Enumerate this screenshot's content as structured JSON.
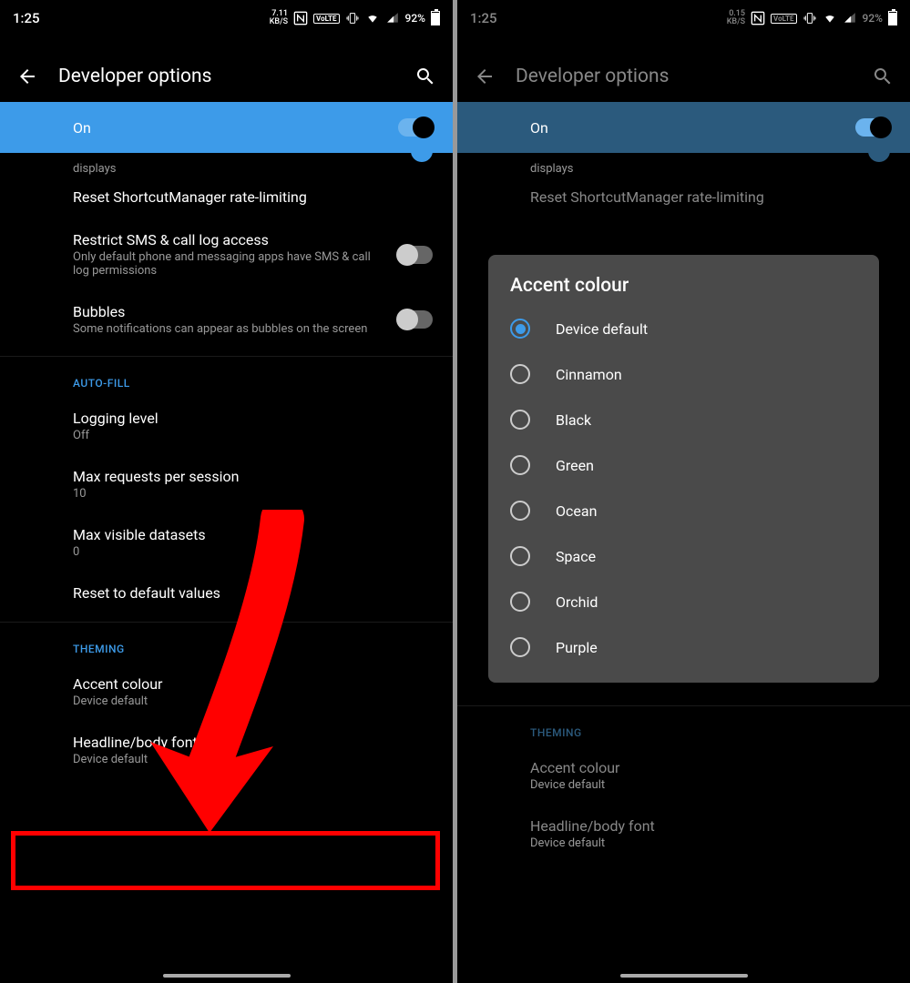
{
  "status": {
    "time": "1:25",
    "kbs_left": "7.11",
    "kbs_right": "0.15",
    "kbs_unit": "KB/S",
    "volte": "VoLTE",
    "battery": "92%"
  },
  "header": {
    "title": "Developer options"
  },
  "switch": {
    "label": "On"
  },
  "trailing_sub": "displays",
  "settings": [
    {
      "title": "Reset ShortcutManager rate-limiting",
      "sub": "",
      "toggle": null
    },
    {
      "title": "Restrict SMS & call log access",
      "sub": "Only default phone and messaging apps have SMS & call log permissions",
      "toggle": "off"
    },
    {
      "title": "Bubbles",
      "sub": "Some notifications can appear as bubbles on the screen",
      "toggle": "off"
    }
  ],
  "sections": {
    "autofill": "AUTO-FILL",
    "theming": "THEMING"
  },
  "autofill_items": [
    {
      "title": "Logging level",
      "sub": "Off"
    },
    {
      "title": "Max requests per session",
      "sub": "10"
    },
    {
      "title": "Max visible datasets",
      "sub": "0"
    },
    {
      "title": "Reset to default values",
      "sub": ""
    }
  ],
  "theming_items": [
    {
      "title": "Accent colour",
      "sub": "Device default"
    },
    {
      "title": "Headline/body font",
      "sub": "Device default"
    }
  ],
  "dialog": {
    "title": "Accent colour",
    "options": [
      "Device default",
      "Cinnamon",
      "Black",
      "Green",
      "Ocean",
      "Space",
      "Orchid",
      "Purple"
    ],
    "selected": 0
  }
}
